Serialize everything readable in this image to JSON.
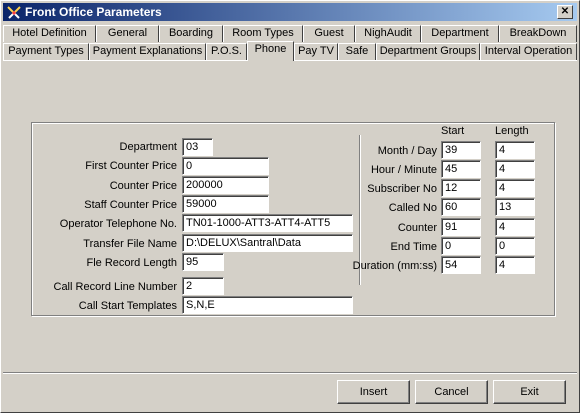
{
  "window": {
    "title": "Front Office Parameters",
    "close_label": "✕"
  },
  "tabs_row1": [
    {
      "label": "Hotel Definition"
    },
    {
      "label": "General"
    },
    {
      "label": "Boarding"
    },
    {
      "label": "Room Types"
    },
    {
      "label": "Guest"
    },
    {
      "label": "NighAudit"
    },
    {
      "label": "Department"
    },
    {
      "label": "BreakDown"
    }
  ],
  "tabs_row2": [
    {
      "label": "Payment Types"
    },
    {
      "label": "Payment Explanations"
    },
    {
      "label": "P.O.S."
    },
    {
      "label": "Phone"
    },
    {
      "label": "Pay TV"
    },
    {
      "label": "Safe"
    },
    {
      "label": "Department Groups"
    },
    {
      "label": "Interval Operation"
    }
  ],
  "active_tab": "Phone",
  "form": {
    "department": {
      "label": "Department",
      "value": "03"
    },
    "first_counter_price": {
      "label": "First Counter Price",
      "value": "0"
    },
    "counter_price": {
      "label": "Counter Price",
      "value": "200000"
    },
    "staff_counter_price": {
      "label": "Staff Counter Price",
      "value": "59000"
    },
    "operator_telephone": {
      "label": "Operator Telephone No.",
      "value": "TN01-1000-ATT3-ATT4-ATT5"
    },
    "transfer_file_name": {
      "label": "Transfer File Name",
      "value": "D:\\DELUX\\Santral\\Data"
    },
    "file_record_length": {
      "label": "Fle Record Length",
      "value": "95"
    },
    "call_record_line_number": {
      "label": "Call Record Line Number",
      "value": "2"
    },
    "call_start_templates": {
      "label": "Call Start Templates",
      "value": "S,N,E"
    }
  },
  "record": {
    "start_header": "Start",
    "length_header": "Length",
    "rows": [
      {
        "label": "Month / Day",
        "start": "39",
        "length": "4"
      },
      {
        "label": "Hour / Minute",
        "start": "45",
        "length": "4"
      },
      {
        "label": "Subscriber No",
        "start": "12",
        "length": "4"
      },
      {
        "label": "Called No",
        "start": "60",
        "length": "13"
      },
      {
        "label": "Counter",
        "start": "91",
        "length": "4"
      },
      {
        "label": "End Time",
        "start": "0",
        "length": "0"
      },
      {
        "label": "Duration (mm:ss)",
        "start": "54",
        "length": "4"
      }
    ]
  },
  "buttons": {
    "insert": "Insert",
    "cancel": "Cancel",
    "exit": "Exit"
  }
}
